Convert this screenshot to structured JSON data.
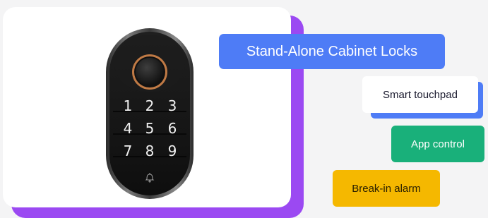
{
  "title": "Stand-Alone Cabinet Locks",
  "features": [
    {
      "label": "Smart touchpad"
    },
    {
      "label": "App control"
    },
    {
      "label": "Break-in alarm"
    }
  ],
  "keypad": {
    "keys": [
      "1",
      "2",
      "3",
      "4",
      "5",
      "6",
      "7",
      "8",
      "9"
    ]
  },
  "colors": {
    "card_shadow": "#9b49f2",
    "title_pill": "#4e7cf6",
    "touchpad_shadow": "#4e7cf6",
    "app_pill": "#19b07a",
    "alarm_pill": "#f5b800",
    "fingerprint_ring": "#c07a45"
  },
  "icons": {
    "bell": "bell-icon",
    "fingerprint": "fingerprint-sensor-icon"
  }
}
